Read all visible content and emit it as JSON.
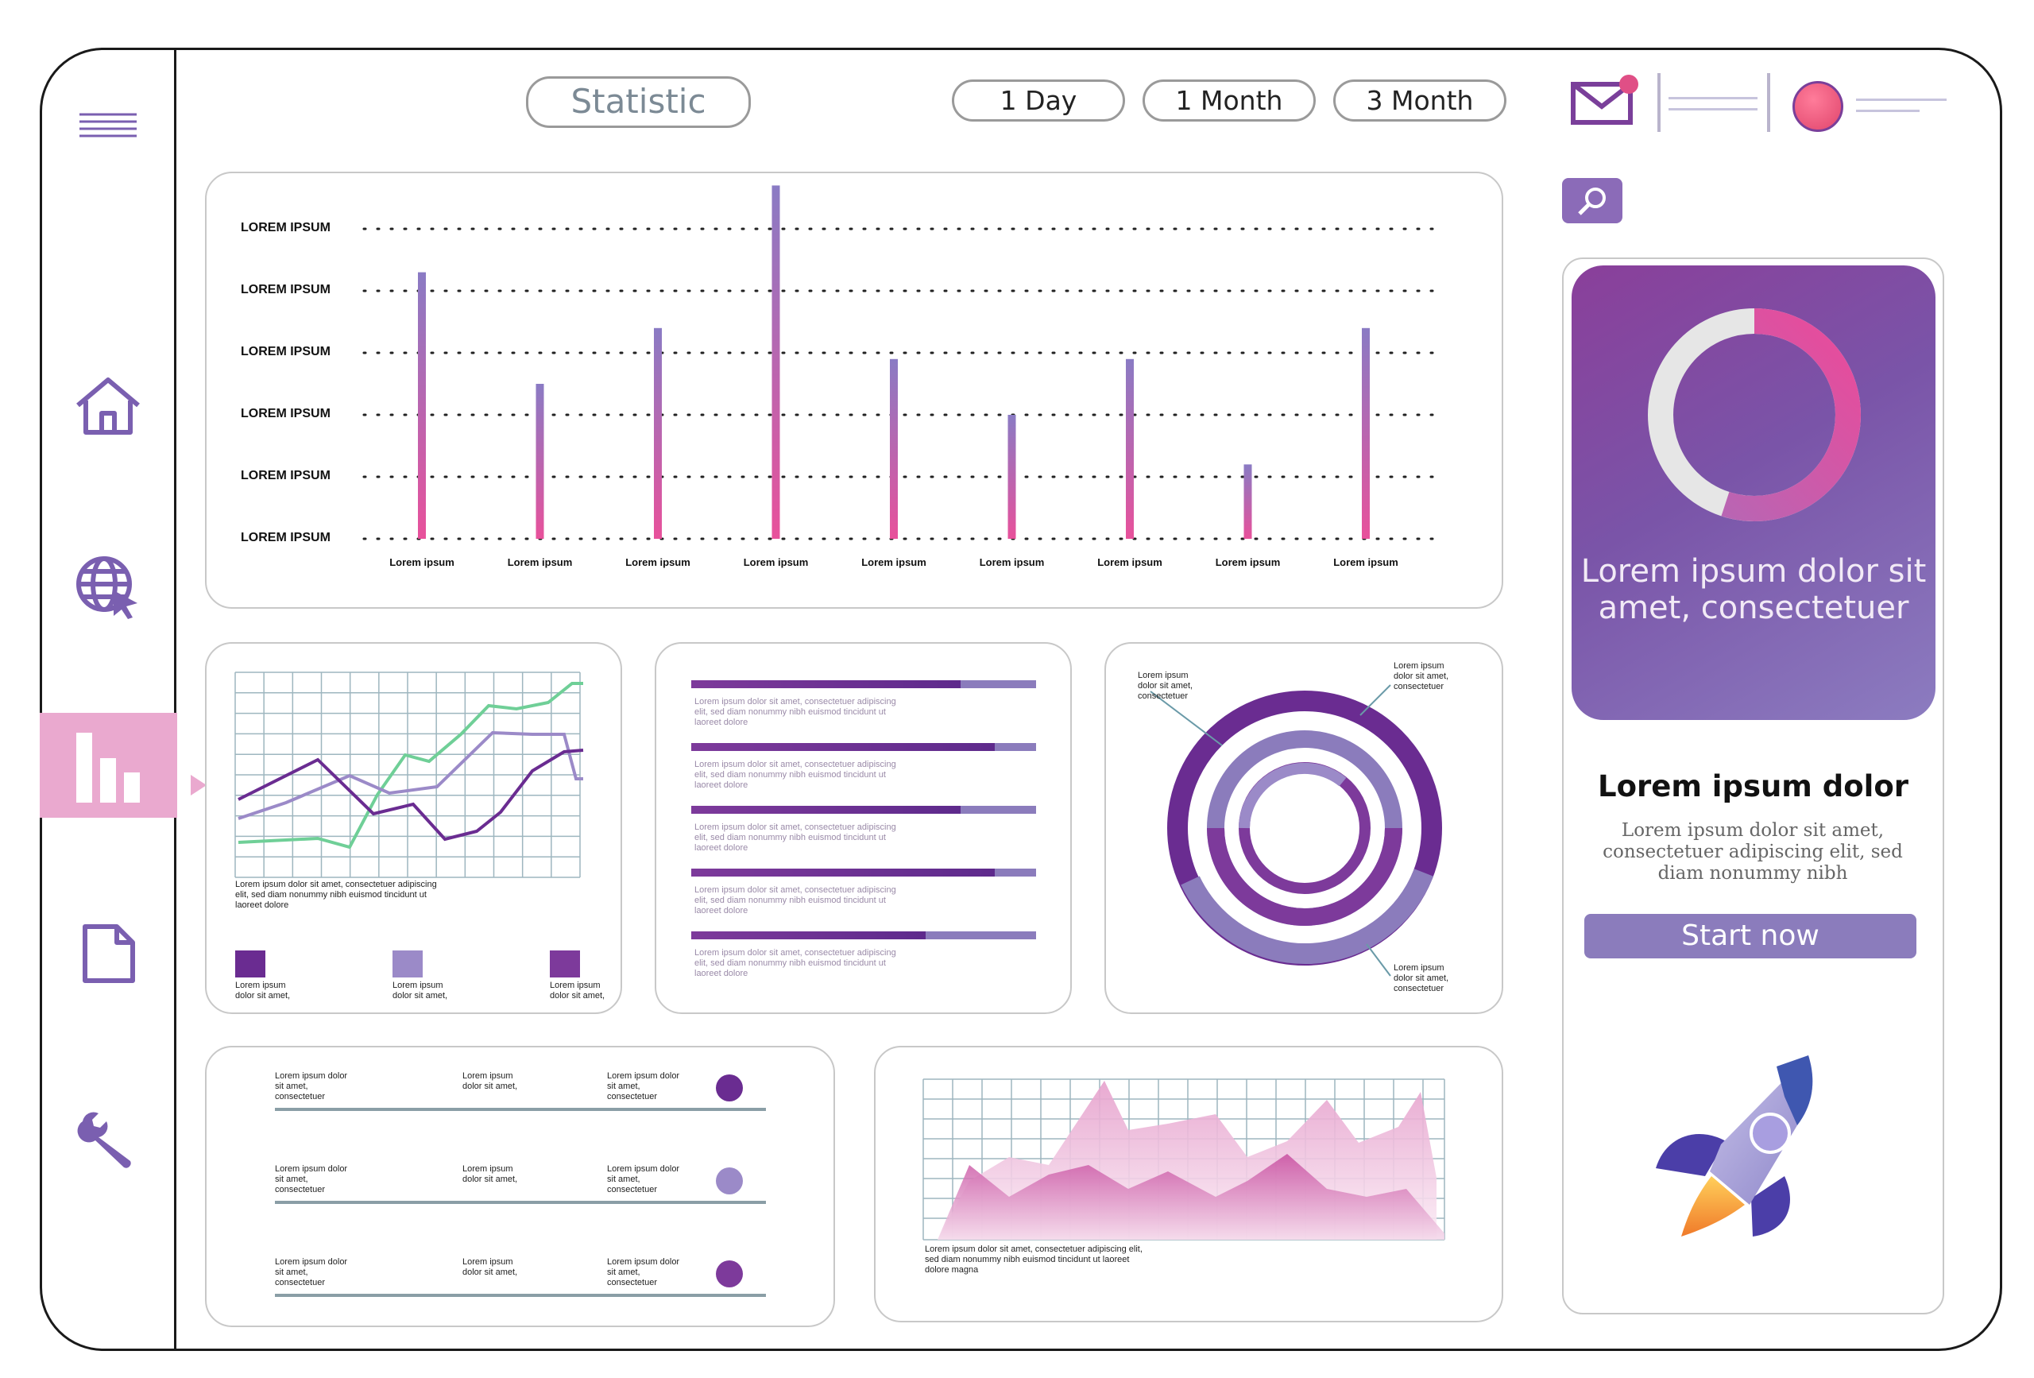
{
  "header": {
    "title": "Statistic",
    "ranges": [
      "1 Day",
      "1 Month",
      "3 Month"
    ]
  },
  "sidebar": {
    "items": [
      {
        "name": "menu",
        "icon": "hamburger-icon"
      },
      {
        "name": "home",
        "icon": "home-icon"
      },
      {
        "name": "web",
        "icon": "globe-cursor-icon"
      },
      {
        "name": "statistics",
        "icon": "bar-chart-icon",
        "active": true
      },
      {
        "name": "documents",
        "icon": "document-icon"
      },
      {
        "name": "settings",
        "icon": "wrench-icon"
      }
    ]
  },
  "colors": {
    "accent_purple": "#6a2c91",
    "mid_purple": "#8b7cbc",
    "light_purple": "#9b8ac8",
    "pink": "#e8519b",
    "sidebar_active": "#eaa9cf",
    "green": "#6fcf97"
  },
  "main_chart": {
    "y_labels": [
      "LOREM IPSUM",
      "LOREM IPSUM",
      "LOREM IPSUM",
      "LOREM IPSUM",
      "LOREM IPSUM",
      "LOREM IPSUM"
    ],
    "x_labels": [
      "Lorem ipsum",
      "Lorem ipsum",
      "Lorem ipsum",
      "Lorem ipsum",
      "Lorem ipsum",
      "Lorem ipsum",
      "Lorem ipsum",
      "Lorem ipsum",
      "Lorem ipsum"
    ]
  },
  "chart_data": {
    "type": "bar",
    "categories": [
      "Lorem ipsum",
      "Lorem ipsum",
      "Lorem ipsum",
      "Lorem ipsum",
      "Lorem ipsum",
      "Lorem ipsum",
      "Lorem ipsum",
      "Lorem ipsum",
      "Lorem ipsum"
    ],
    "values": [
      4.3,
      2.5,
      3.4,
      5.7,
      2.9,
      2.0,
      2.9,
      1.2,
      3.4
    ],
    "ylim": [
      0,
      5
    ],
    "grid": "dotted horizontal"
  },
  "line_chart_card": {
    "caption": "Lorem ipsum dolor sit amet, consectetuer adipiscing elit, sed diam nonummy nibh euismod tincidunt ut laoreet dolore",
    "legend": [
      {
        "text": "Lorem ipsum dolor sit amet,",
        "color": "#6a2c91"
      },
      {
        "text": "Lorem ipsum dolor sit amet,",
        "color": "#9b8ac8"
      },
      {
        "text": "Lorem ipsum dolor sit amet,",
        "color": "#7d3a9b"
      }
    ]
  },
  "progress_card": {
    "items": [
      {
        "text": "Lorem ipsum dolor sit amet, consectetuer adipiscing elit, sed diam nonummy nibh euismod tincidunt ut laoreet dolore",
        "value": 0.78
      },
      {
        "text": "Lorem ipsum dolor sit amet, consectetuer adipiscing elit, sed diam nonummy nibh euismod tincidunt ut laoreet dolore",
        "value": 0.88
      },
      {
        "text": "Lorem ipsum dolor sit amet, consectetuer adipiscing elit, sed diam nonummy nibh euismod tincidunt ut laoreet dolore",
        "value": 0.78
      },
      {
        "text": "Lorem ipsum dolor sit amet, consectetuer adipiscing elit, sed diam nonummy nibh euismod tincidunt ut laoreet dolore",
        "value": 0.88
      },
      {
        "text": "Lorem ipsum dolor sit amet, consectetuer adipiscing elit, sed diam nonummy nibh euismod tincidunt ut laoreet dolore",
        "value": 0.68
      }
    ]
  },
  "rings_card": {
    "labels": [
      "Lorem ipsum dolor sit amet, consectetuer",
      "Lorem ipsum dolor sit amet, consectetuer",
      "Lorem ipsum dolor sit amet, consectetuer"
    ]
  },
  "table_card": {
    "rows": [
      {
        "c1": "Lorem ipsum dolor sit amet, consectetuer",
        "c2": "Lorem ipsum dolor sit amet,",
        "c3": "Lorem ipsum dolor sit amet, consectetuer",
        "dot": "#6a2c91"
      },
      {
        "c1": "Lorem ipsum dolor sit amet, consectetuer",
        "c2": "Lorem ipsum dolor sit amet,",
        "c3": "Lorem ipsum dolor sit amet, consectetuer",
        "dot": "#9b8ac8"
      },
      {
        "c1": "Lorem ipsum dolor sit amet, consectetuer",
        "c2": "Lorem ipsum dolor sit amet,",
        "c3": "Lorem ipsum dolor sit amet, consectetuer",
        "dot": "#7d3a9b"
      }
    ]
  },
  "area_card": {
    "caption": "Lorem ipsum dolor sit amet, consectetuer adipiscing elit, sed diam nonummy nibh euismod tincidunt ut laoreet dolore magna"
  },
  "right_panel": {
    "hero_text": "Lorem ipsum dolor sit amet, consectetuer",
    "title": "Lorem ipsum dolor",
    "description": "Lorem ipsum dolor sit amet, consectetuer adipiscing elit, sed diam nonummy nibh",
    "button_label": "Start now",
    "ring_progress": 0.55
  }
}
